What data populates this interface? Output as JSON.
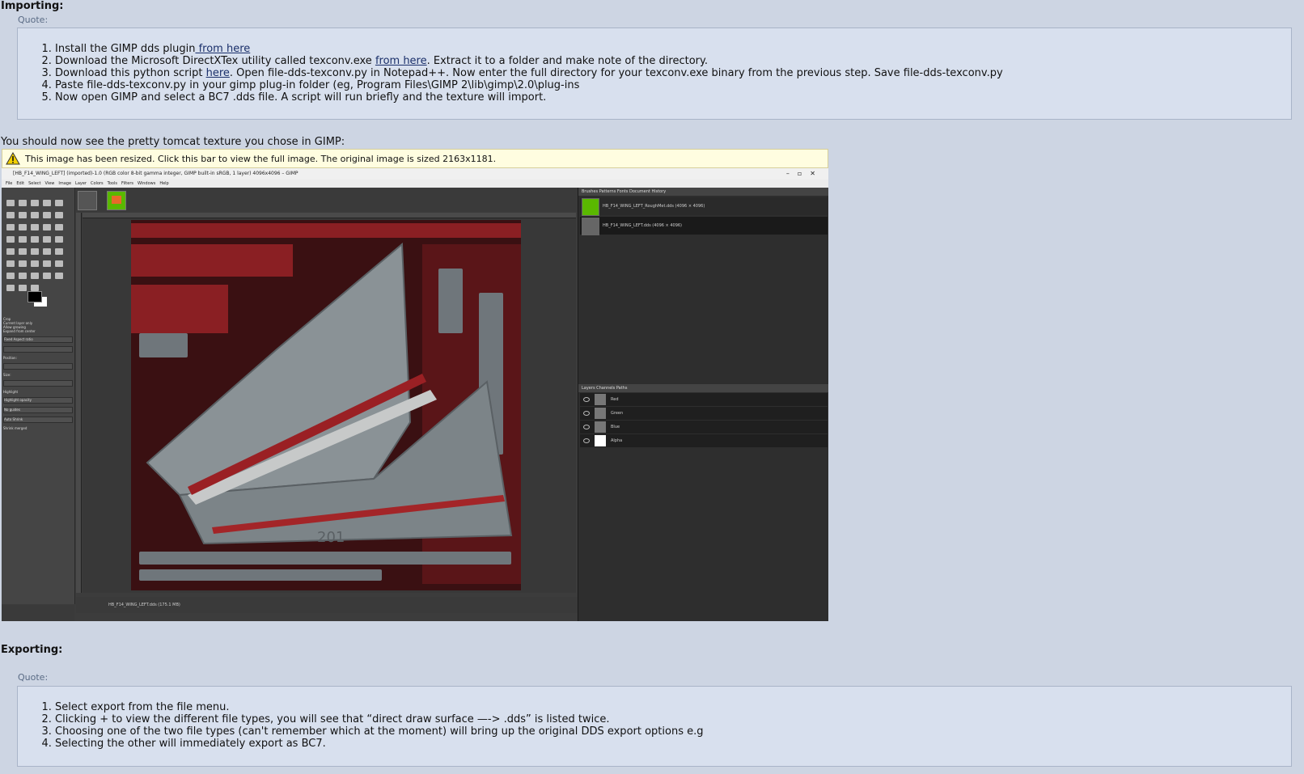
{
  "importing": {
    "heading": "Importing:",
    "quote_label": "Quote:",
    "steps": [
      {
        "pre": "Install the GIMP dds plugin",
        "link": " from here",
        "post": ""
      },
      {
        "pre": "Download the Microsoft DirectXTex utility called texconv.exe ",
        "link": "from here",
        "post": ". Extract it to a folder and make note of the directory."
      },
      {
        "pre": "Download this python script ",
        "link": "here",
        "post": ". Open file-dds-texconv.py in Notepad++. Now enter the full directory for your texconv.exe binary from the previous step. Save file-dds-texconv.py"
      },
      {
        "pre": "Paste file-dds-texconv.py in your gimp plug-in folder (eg, Program Files\\GIMP 2\\lib\\gimp\\2.0\\plug-ins",
        "link": "",
        "post": ""
      },
      {
        "pre": "Now open GIMP and select a BC7 .dds file. A script will run briefly and the texture will import.",
        "link": "",
        "post": ""
      }
    ]
  },
  "sentence": "You should now see the pretty tomcat texture you chose in GIMP:",
  "resize_notice": "This image has been resized. Click this bar to view the full image. The original image is sized 2163x1181.",
  "gimp": {
    "title": "[HB_F14_WING_LEFT] (imported)-1.0 (RGB color 8-bit gamma integer, GIMP built-in sRGB, 1 layer) 4096x4096 – GIMP",
    "menu": [
      "File",
      "Edit",
      "Select",
      "View",
      "Image",
      "Layer",
      "Colors",
      "Tools",
      "Filters",
      "Windows",
      "Help"
    ],
    "status": "HB_F14_WING_LEFT.dds (175.1 MB)",
    "panel_tabs": "Brushes  Patterns  Fonts  Document History",
    "history": [
      "HB_F14_WING_LEFT_RoughMet.dds (4096 × 4096)",
      "HB_F14_WING_LEFT.dds (4096 × 4096)"
    ],
    "layer_tabs": "Layers  Channels  Paths",
    "channels": [
      "Red",
      "Green",
      "Blue",
      "Alpha"
    ],
    "tool_options": [
      "Crop",
      "Current layer only",
      "Allow growing",
      "Expand from center",
      "Fixed  Aspect ratio",
      "Position:",
      "Size:",
      "Highlight",
      "Highlight opacity",
      "No guides",
      "Auto Shrink",
      "Shrink merged"
    ]
  },
  "exporting": {
    "heading": "Exporting:",
    "quote_label": "Quote:",
    "steps": [
      "Select export from the file menu.",
      "Clicking + to view the different file types, you will see that “direct draw surface —-> .dds” is listed twice.",
      "Choosing one of the two file types (can't remember which at the moment) will bring up the original DDS export options e.g",
      "Selecting the other will immediately export as BC7."
    ]
  },
  "colors": {
    "background": "#cdd5e3",
    "quote_bg": "#d8e0ee",
    "link": "#1a2f6a",
    "notice_bg": "#fffde0"
  }
}
